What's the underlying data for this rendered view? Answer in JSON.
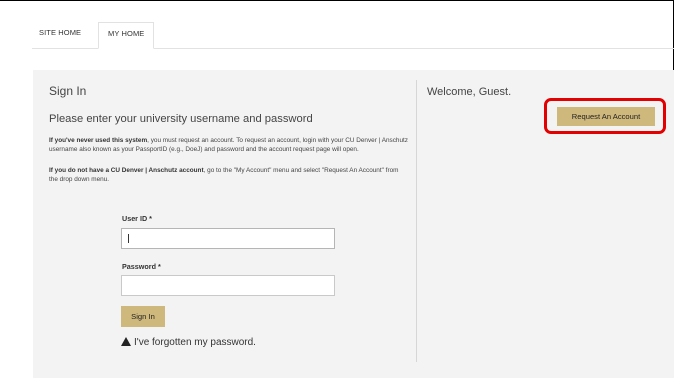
{
  "tabs": [
    {
      "label": "SITE HOME"
    },
    {
      "label": "MY HOME"
    }
  ],
  "signin": {
    "title": "Sign In",
    "subtitle": "Please enter your university username and password",
    "para1_bold": "If you've never used this system",
    "para1_rest": ", you must request an account. To request an account, login with your CU Denver | Anschutz username also known as your PassportID (e.g., DoeJ) and password and the account request page will open.",
    "para2_bold": "If you do not have a CU Denver | Anschutz account",
    "para2_rest": ", go to the \"My Account\" menu and select \"Request An Account\" from the drop down menu.",
    "user_label": "User ID *",
    "user_value": "",
    "password_label": "Password *",
    "password_value": "",
    "button_label": "Sign In",
    "forgot_label": "I've forgotten my password."
  },
  "welcome": {
    "text": "Welcome, Guest.",
    "request_button": "Request An Account"
  },
  "icons": {
    "forgot": "warning-triangle-icon"
  },
  "colors": {
    "accent": "#cfb87c",
    "highlight": "#e30000",
    "panel": "#f3f3f3"
  }
}
